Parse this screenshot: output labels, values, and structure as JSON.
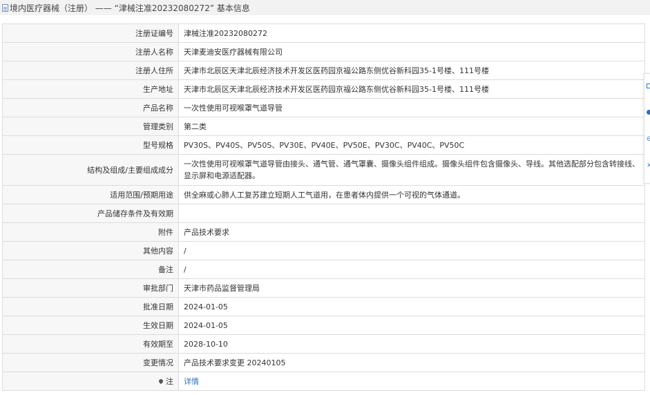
{
  "header": {
    "title": "境内医疗器械（注册） —— “津械注准20232080272” 基本信息"
  },
  "rows": [
    {
      "label": "注册证编号",
      "value": "津械注准20232080272"
    },
    {
      "label": "注册人名称",
      "value": "天津麦迪安医疗器械有限公司"
    },
    {
      "label": "注册人住所",
      "value": "天津市北辰区天津北辰经济技术开发区医药园京福公路东侧优谷新科园35-1号楼、111号楼"
    },
    {
      "label": "生产地址",
      "value": "天津市北辰区天津北辰经济技术开发区医药园京福公路东侧优谷新科园35-1号楼、111号楼"
    },
    {
      "label": "产品名称",
      "value": "一次性使用可视喉罩气道导管"
    },
    {
      "label": "管理类别",
      "value": "第二类"
    },
    {
      "label": "型号规格",
      "value": "PV30S、PV40S、PV50S、PV30E、PV40E、PV50E、PV30C、PV40C、PV50C"
    },
    {
      "label": "结构及组成/主要组成成分",
      "value": "一次性使用可视喉罩气道导管由接头、通气管、通气罩囊、摄像头组件组成。摄像头组件包含摄像头、导线。其他选配部分包含转接线、显示屏和电源适配器。"
    },
    {
      "label": "适用范围/预期用途",
      "value": "供全麻或心肺人工复苏建立短期人工气道用，在患者体内提供一个可视的气体通道。"
    },
    {
      "label": "产品储存条件及有效期",
      "value": ""
    },
    {
      "label": "附件",
      "value": "产品技术要求"
    },
    {
      "label": "其他内容",
      "value": "/"
    },
    {
      "label": "备注",
      "value": "/"
    },
    {
      "label": "审批部门",
      "value": "天津市药品监督管理局"
    },
    {
      "label": "批准日期",
      "value": "2024-01-05"
    },
    {
      "label": "生效日期",
      "value": "2024-01-05"
    },
    {
      "label": "有效期至",
      "value": "2028-10-10"
    },
    {
      "label": "变更情况",
      "value": "产品技术要求变更 20240105"
    }
  ],
  "note_row": {
    "label": "注",
    "link_text": "详情",
    "icon": "pin-icon"
  },
  "side_panel": {
    "icons": [
      "document-icon",
      "circle-icon",
      "link-icon",
      "close-icon"
    ]
  }
}
